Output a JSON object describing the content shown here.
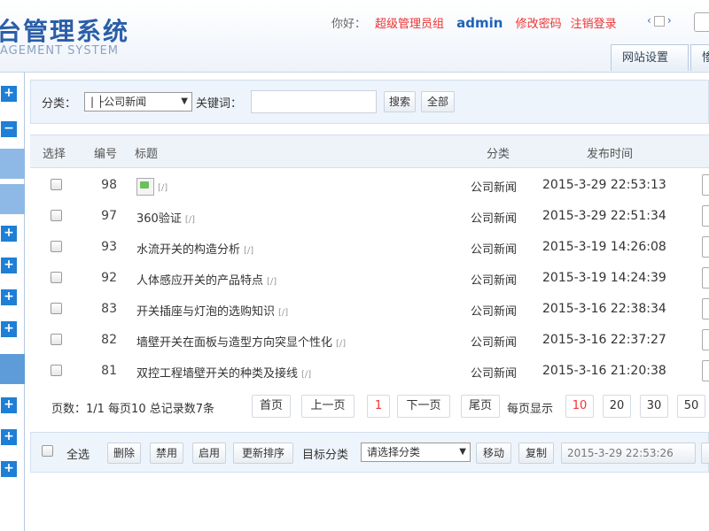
{
  "header": {
    "logo_title": "台管理系统",
    "logo_subtitle": "AGEMENT SYSTEM",
    "hello": "你好：",
    "role": "超级管理员组",
    "username": "admin",
    "change_password": "修改密码",
    "logout": "注销登录",
    "tabs": [
      "网站设置",
      "惨"
    ]
  },
  "search": {
    "category_label": "分类：",
    "category_selected": "| ├公司新闻",
    "keyword_label": "关键词：",
    "keyword_value": "",
    "search_button": "搜索",
    "all_button": "全部"
  },
  "table": {
    "headers": {
      "select": "选择",
      "id": "编号",
      "title": "标题",
      "category": "分类",
      "time": "发布时间"
    },
    "rows": [
      {
        "id": "98",
        "title": "",
        "category": "公司新闻",
        "time": "2015-3-29 22:53:13"
      },
      {
        "id": "97",
        "title": "360验证",
        "category": "公司新闻",
        "time": "2015-3-29 22:51:34"
      },
      {
        "id": "93",
        "title": "水流开关的构造分析",
        "category": "公司新闻",
        "time": "2015-3-19 14:26:08"
      },
      {
        "id": "92",
        "title": "人体感应开关的产品特点",
        "category": "公司新闻",
        "time": "2015-3-19 14:24:39"
      },
      {
        "id": "83",
        "title": "开关插座与灯泡的选购知识",
        "category": "公司新闻",
        "time": "2015-3-16 22:38:34"
      },
      {
        "id": "82",
        "title": "墙壁开关在面板与造型方向突显个性化",
        "category": "公司新闻",
        "time": "2015-3-16 22:37:27"
      },
      {
        "id": "81",
        "title": "双控工程墙壁开关的种类及接线",
        "category": "公司新闻",
        "time": "2015-3-16 21:20:38"
      }
    ]
  },
  "pager": {
    "info": "页数：1/1 每页10 总记录数7条",
    "first": "首页",
    "prev": "上一页",
    "current": "1",
    "next": "下一页",
    "last": "尾页",
    "per_page_label": "每页显示",
    "per_page_options": [
      "10",
      "20",
      "30",
      "50"
    ]
  },
  "actions": {
    "select_all": "全选",
    "delete": "删除",
    "disable": "禁用",
    "enable": "启用",
    "update_sort": "更新排序",
    "target_category_label": "目标分类",
    "target_category_placeholder": "请选择分类",
    "move": "移动",
    "copy": "复制",
    "datetime_value": "2015-3-29 22:53:26"
  },
  "colors": {
    "accent": "#1e7fd6",
    "brand_title": "#2a5ea8",
    "alert_red": "#ee3333"
  }
}
